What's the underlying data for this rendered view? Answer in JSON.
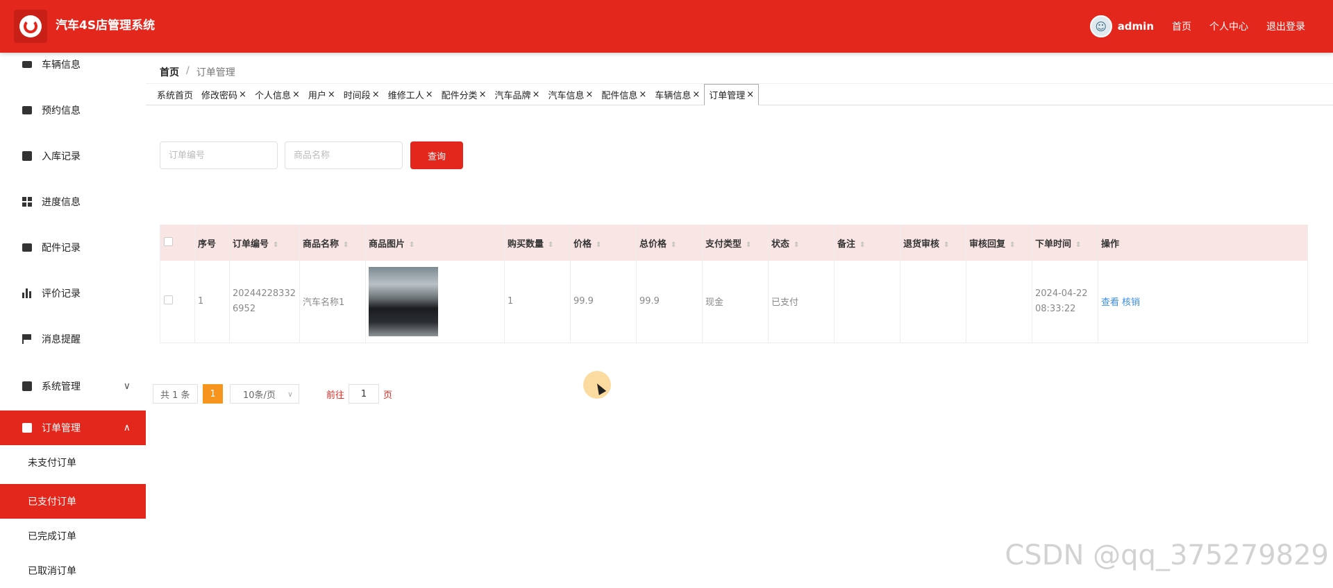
{
  "header": {
    "app_title": "汽车4S店管理系统",
    "user_name": "admin",
    "links": [
      "首页",
      "个人中心",
      "退出登录"
    ]
  },
  "sidebar": {
    "items": [
      {
        "label": "车辆信息",
        "icon": "ticket-icon"
      },
      {
        "label": "预约信息",
        "icon": "briefcase-icon"
      },
      {
        "label": "入库记录",
        "icon": "printer-icon"
      },
      {
        "label": "进度信息",
        "icon": "grid-icon"
      },
      {
        "label": "配件记录",
        "icon": "box-icon"
      },
      {
        "label": "评价记录",
        "icon": "bar-chart-icon"
      },
      {
        "label": "消息提醒",
        "icon": "flag-icon"
      },
      {
        "label": "系统管理",
        "icon": "clipboard-icon"
      },
      {
        "label": "订单管理",
        "icon": "order-icon"
      }
    ],
    "subitems": [
      "未支付订单",
      "已支付订单",
      "已完成订单",
      "已取消订单"
    ]
  },
  "breadcrumb": {
    "home": "首页",
    "separator": "/",
    "current": "订单管理"
  },
  "tabs": [
    "系统首页",
    "修改密码",
    "个人信息",
    "用户",
    "时间段",
    "维修工人",
    "配件分类",
    "汽车品牌",
    "汽车信息",
    "配件信息",
    "车辆信息",
    "订单管理"
  ],
  "search": {
    "order_no_placeholder": "订单编号",
    "product_name_placeholder": "商品名称",
    "query_label": "查询"
  },
  "table": {
    "columns": [
      "序号",
      "订单编号",
      "商品名称",
      "商品图片",
      "购买数量",
      "价格",
      "总价格",
      "支付类型",
      "状态",
      "备注",
      "退货审核",
      "审核回复",
      "下单时间",
      "操作"
    ],
    "rows": [
      {
        "index": "1",
        "order_no": "202442283326952",
        "product_name": "汽车名称1",
        "quantity": "1",
        "price": "99.9",
        "total": "99.9",
        "pay_type": "现金",
        "status": "已支付",
        "remark": "",
        "return_review": "",
        "review_reply": "",
        "order_time": "2024-04-22 08:33:22",
        "actions": [
          "查看",
          "核销"
        ]
      }
    ]
  },
  "pagination": {
    "total": "共 1 条",
    "current_page": "1",
    "page_size": "10条/页",
    "goto_prefix": "前往",
    "goto_value": "1",
    "goto_suffix": "页"
  },
  "watermark": "CSDN @qq_375279829",
  "colors": {
    "accent": "#e4271d",
    "page_active": "#f7941d",
    "link": "#3a8ee6"
  }
}
